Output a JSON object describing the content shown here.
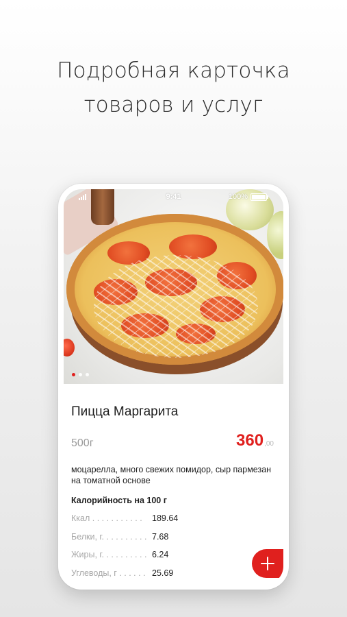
{
  "headline": {
    "line1": "Подробная карточка",
    "line2": "товаров и услуг"
  },
  "status_bar": {
    "time": "9:41",
    "battery": "100%"
  },
  "carousel": {
    "slides": 3,
    "active_index": 0
  },
  "product": {
    "title": "Пицца Маргарита",
    "weight": "500г",
    "price": "360",
    "price_cents": ",00",
    "description": "моцарелла, много свежих помидор, сыр пармезан на томатной основе",
    "calories_title": "Калорийность на 100 г",
    "nutrition": [
      {
        "label": "Ккал . . . . . . . . . . .",
        "value": "189.64"
      },
      {
        "label": "Белки, г. . . . . . . . . .",
        "value": "7.68"
      },
      {
        "label": "Жиры, г. . . . . . . . . .",
        "value": "6.24"
      },
      {
        "label": "Углеводы, г . . . . . .",
        "value": "25.69"
      }
    ]
  },
  "colors": {
    "accent": "#e0201e",
    "muted": "#9a9a9a",
    "text": "#1e1e1e"
  },
  "icons": {
    "add": "plus-icon",
    "signal": "signal-icon",
    "battery": "battery-icon"
  }
}
